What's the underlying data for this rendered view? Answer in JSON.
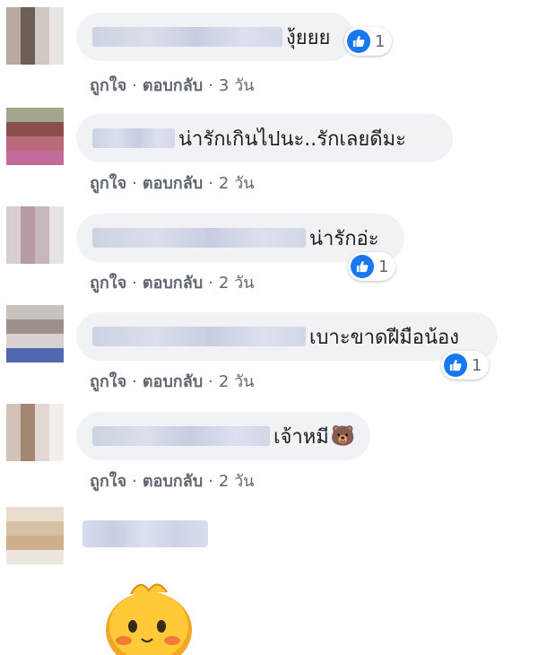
{
  "comments": [
    {
      "text": "งุ้ยยย",
      "like": "ถูกใจ",
      "reply": "ตอบกลับ",
      "time": "3 วัน",
      "reactions": "1"
    },
    {
      "text": "น่ารักเกินไปนะ..รักเลยดีมะ",
      "like": "ถูกใจ",
      "reply": "ตอบกลับ",
      "time": "2 วัน",
      "reactions": ""
    },
    {
      "text": "น่ารักอ่ะ",
      "like": "ถูกใจ",
      "reply": "ตอบกลับ",
      "time": "2 วัน",
      "reactions": "1"
    },
    {
      "text": "เบาะขาดฝีมือน้อง",
      "like": "ถูกใจ",
      "reply": "ตอบกลับ",
      "time": "2 วัน",
      "reactions": "1"
    },
    {
      "text": "เจ้าหมี",
      "like": "ถูกใจ",
      "reply": "ตอบกลับ",
      "time": "2 วัน",
      "reactions": ""
    }
  ],
  "separator": "·",
  "emoji": "🐻",
  "colors": {
    "like_blue": "#1877f2",
    "bubble_bg": "#f0f2f5",
    "meta": "#606770"
  }
}
